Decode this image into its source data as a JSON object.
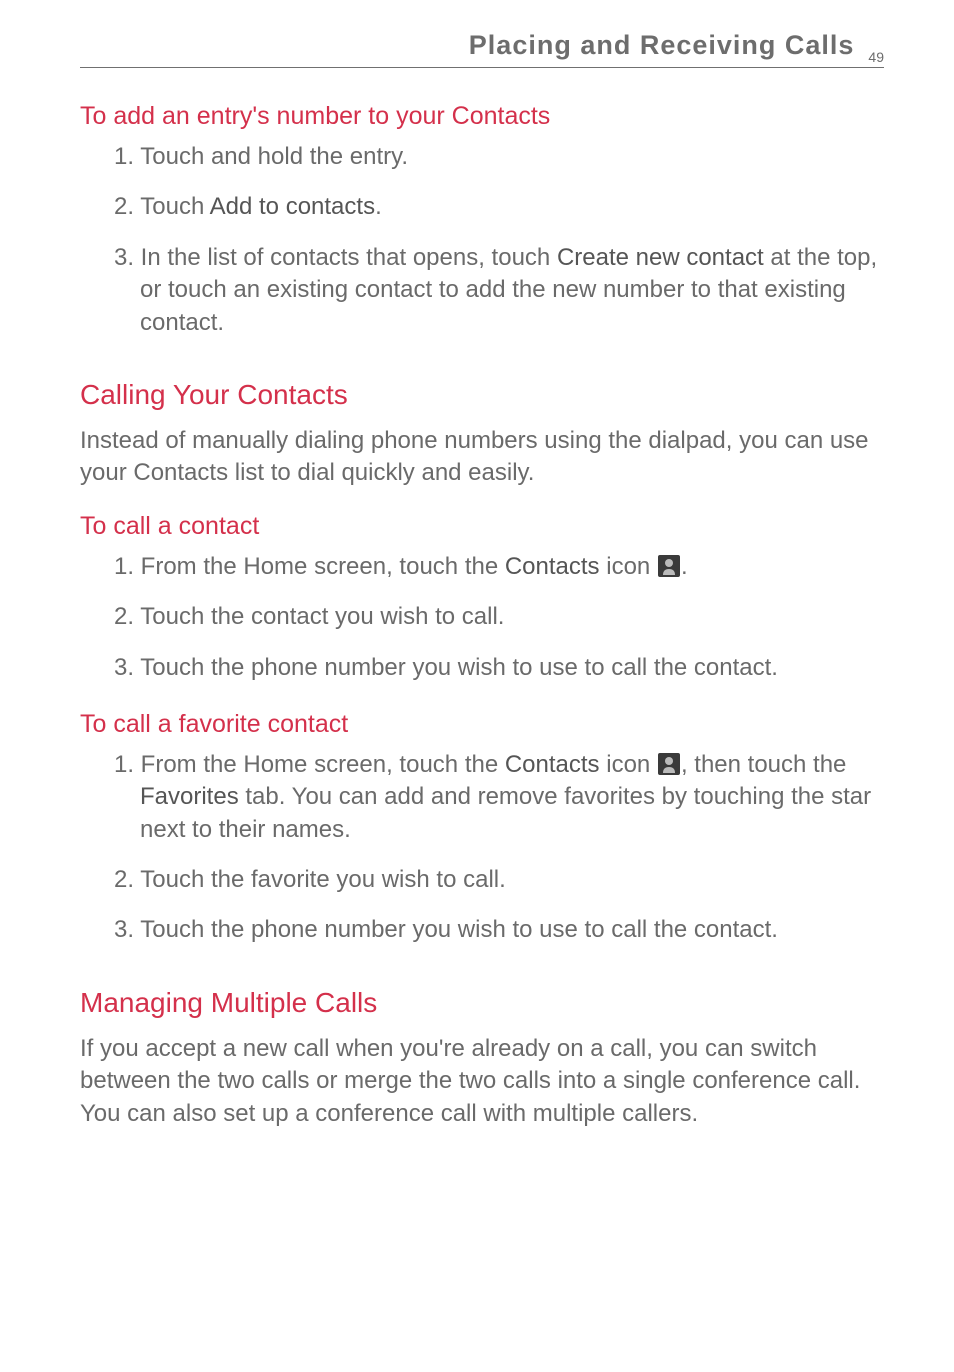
{
  "header": {
    "title": "Placing and Receiving Calls",
    "page_number": "49"
  },
  "sections": {
    "add_entry": {
      "heading": "To add an entry's number to your Contacts",
      "step1_prefix": "1. Touch and hold the entry.",
      "step2_prefix": "2. Touch ",
      "step2_bold": "Add to contacts",
      "step2_suffix": ".",
      "step3_prefix": "3. In the list of contacts that opens, touch ",
      "step3_bold": "Create new contact",
      "step3_suffix": " at the top, or touch an existing contact to add the new number to that existing contact."
    },
    "calling_contacts": {
      "heading": "Calling Your Contacts",
      "intro": "Instead of manually dialing phone numbers using the dialpad, you can use your Contacts list to dial quickly and easily."
    },
    "to_call": {
      "heading": "To call a contact",
      "step1_prefix": "1. From the Home screen, touch the ",
      "step1_bold": "Contacts",
      "step1_mid": " icon ",
      "step1_suffix": ".",
      "step2": "2. Touch the contact you wish to call.",
      "step3": "3. Touch the phone number you wish to use to call the contact."
    },
    "to_call_fav": {
      "heading": "To call a favorite contact",
      "step1_prefix": "1. From the Home screen, touch the ",
      "step1_bold1": "Contacts",
      "step1_mid1": " icon ",
      "step1_mid2": ", then touch the ",
      "step1_bold2": "Favorites",
      "step1_suffix": " tab. You can add and remove favorites by touching the star next to their names.",
      "step2": "2. Touch the favorite you wish to call.",
      "step3": "3. Touch the phone number you wish to use to call the contact."
    },
    "managing": {
      "heading": "Managing Multiple Calls",
      "intro": "If you accept a new call when you're already on a call, you can switch between the two calls or merge the two calls into a single conference call. You can also set up a conference call with multiple callers."
    }
  }
}
